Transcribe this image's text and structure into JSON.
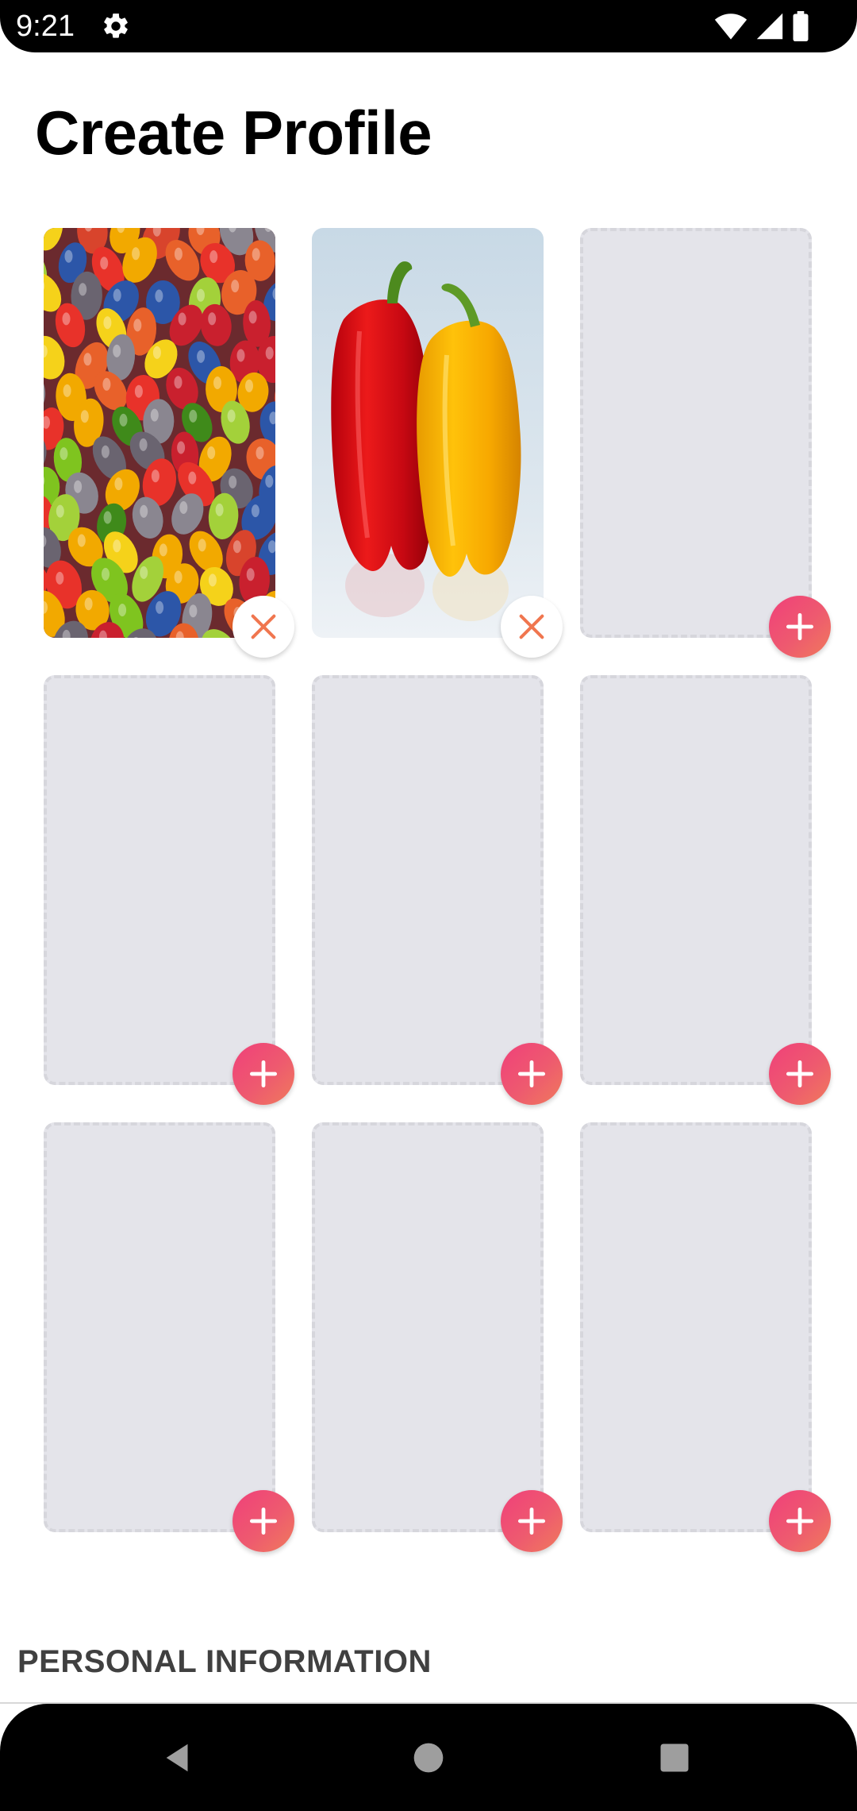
{
  "status_bar": {
    "time": "9:21",
    "icons": [
      "gear-icon",
      "wifi-icon",
      "signal-icon",
      "battery-icon"
    ]
  },
  "header": {
    "title": "Create Profile"
  },
  "photo_grid": {
    "slots": [
      {
        "state": "filled",
        "image": "jelly-beans-photo",
        "action": "remove"
      },
      {
        "state": "filled",
        "image": "bell-peppers-photo",
        "action": "remove"
      },
      {
        "state": "empty",
        "action": "add"
      },
      {
        "state": "empty",
        "action": "add"
      },
      {
        "state": "empty",
        "action": "add"
      },
      {
        "state": "empty",
        "action": "add"
      },
      {
        "state": "empty",
        "action": "add"
      },
      {
        "state": "empty",
        "action": "add"
      },
      {
        "state": "empty",
        "action": "add"
      }
    ]
  },
  "sections": {
    "personal_info_title": "PERSONAL INFORMATION"
  },
  "nav_bar": {
    "buttons": [
      "back-icon",
      "home-icon",
      "recents-icon"
    ]
  },
  "colors": {
    "add_gradient_start": "#f0407a",
    "add_gradient_end": "#f07a5c",
    "remove_x": "#f0764f",
    "empty_slot_bg": "#e4e4ea"
  }
}
